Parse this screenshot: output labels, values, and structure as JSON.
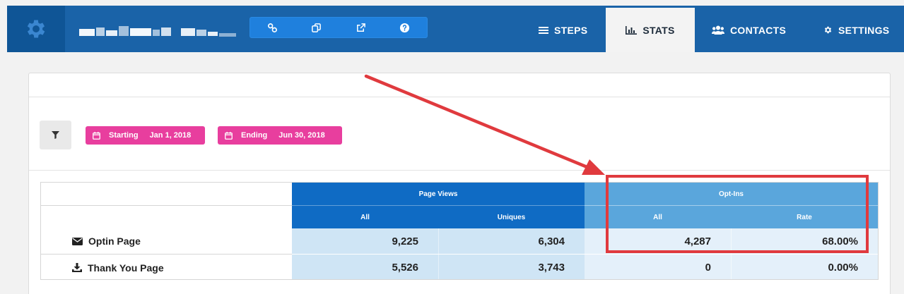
{
  "icons": {
    "settings_gear": "gear-icon",
    "link": "link-icon",
    "clone": "clone-icon",
    "external": "external-link-icon",
    "help": "question-icon",
    "steps": "list-icon",
    "stats": "bar-chart-icon",
    "contacts": "users-icon",
    "settings": "cog-icon",
    "filter": "filter-icon",
    "calendar": "calendar-icon",
    "envelope": "envelope-icon",
    "download": "download-icon"
  },
  "nav": {
    "steps": "STEPS",
    "stats": "STATS",
    "contacts": "CONTACTS",
    "settings": "SETTINGS",
    "active": "stats"
  },
  "filters": {
    "starting_label": "Starting",
    "starting_value": "Jan 1, 2018",
    "ending_label": "Ending",
    "ending_value": "Jun 30, 2018"
  },
  "table": {
    "groups": [
      {
        "label": "Page Views",
        "columns": [
          "All",
          "Uniques"
        ]
      },
      {
        "label": "Opt-Ins",
        "columns": [
          "All",
          "Rate"
        ]
      }
    ],
    "rows": [
      {
        "label": "Optin Page",
        "icon": "envelope-icon",
        "values": [
          "9,225",
          "6,304",
          "4,287",
          "68.00%"
        ]
      },
      {
        "label": "Thank You Page",
        "icon": "download-icon",
        "values": [
          "5,526",
          "3,743",
          "0",
          "0.00%"
        ]
      }
    ]
  },
  "colors": {
    "topbar": "#1a63a8",
    "pink_pill": "#e83e9e",
    "page_views_header": "#0f6bc4",
    "optins_header": "#5aa6dc",
    "highlight": "#e03a3e"
  }
}
